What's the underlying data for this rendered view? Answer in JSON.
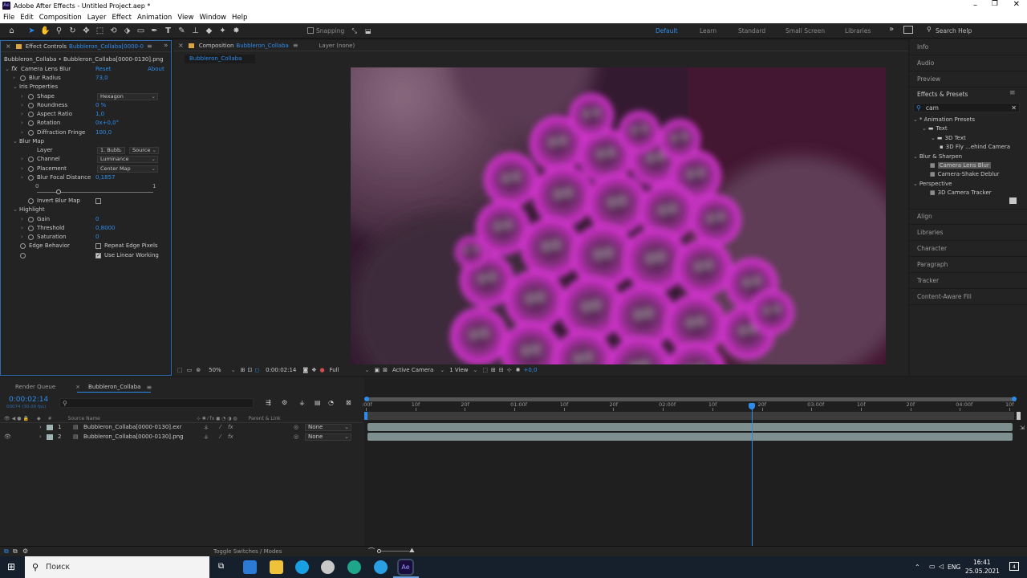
{
  "app": {
    "title": "Adobe After Effects - Untitled Project.aep *"
  },
  "menu": [
    "File",
    "Edit",
    "Composition",
    "Layer",
    "Effect",
    "Animation",
    "View",
    "Window",
    "Help"
  ],
  "toolbar": {
    "snapping": "Snapping",
    "workspaces": [
      "Default",
      "Learn",
      "Standard",
      "Small Screen",
      "Libraries"
    ],
    "search_placeholder": "Search Help"
  },
  "effect_controls": {
    "tab_prefix": "Effect Controls",
    "tab_layer": "Bubbleron_Collaba[0000-01:",
    "path": "Bubbleron_Collaba • Bubbleron_Collaba[0000-0130].png",
    "effect_name": "Camera Lens Blur",
    "reset": "Reset",
    "about": "About",
    "rows": [
      {
        "label": "Blur Radius",
        "value": "73,0",
        "indent": 1,
        "stopwatch": true
      },
      {
        "label": "Iris Properties",
        "indent": 1,
        "group": true
      },
      {
        "label": "Shape",
        "dropdown": "Hexagon",
        "indent": 2,
        "stopwatch": true
      },
      {
        "label": "Roundness",
        "value": "0 %",
        "indent": 2,
        "stopwatch": true
      },
      {
        "label": "Aspect Ratio",
        "value": "1,0",
        "indent": 2,
        "stopwatch": true
      },
      {
        "label": "Rotation",
        "value": "0x+0,0°",
        "indent": 2,
        "stopwatch": true
      },
      {
        "label": "Diffraction Fringe",
        "value": "100,0",
        "indent": 2,
        "stopwatch": true
      },
      {
        "label": "Blur Map",
        "indent": 1,
        "group": true
      },
      {
        "label": "Layer",
        "dropdown": "1. Bubb",
        "dropdown2": "Source",
        "indent": 2
      },
      {
        "label": "Channel",
        "dropdown": "Luminance",
        "indent": 2,
        "stopwatch": true
      },
      {
        "label": "Placement",
        "dropdown": "Center Map",
        "indent": 2,
        "stopwatch": true
      },
      {
        "label": "Blur Focal Distance",
        "value": "0,1857",
        "indent": 2,
        "stopwatch": true
      },
      {
        "label": "Invert Blur Map",
        "checkbox": false,
        "indent": 2,
        "stopwatch": true
      },
      {
        "label": "Highlight",
        "indent": 1,
        "group": true
      },
      {
        "label": "Gain",
        "value": "0",
        "indent": 2,
        "stopwatch": true
      },
      {
        "label": "Threshold",
        "value": "0,8000",
        "indent": 2,
        "stopwatch": true
      },
      {
        "label": "Saturation",
        "value": "0",
        "indent": 2,
        "stopwatch": true
      },
      {
        "label": "Edge Behavior",
        "checkbox_label": "Repeat Edge Pixels",
        "checkbox": false,
        "indent": 1,
        "stopwatch": true
      },
      {
        "label": "",
        "checkbox_label": "Use Linear Working",
        "checkbox": true,
        "indent": 1,
        "stopwatch": true
      }
    ],
    "slider_min": "0",
    "slider_max": "1",
    "slider_value": 0.1857
  },
  "composition": {
    "tab_prefix": "Composition",
    "tab_name": "Bubbleron_Collaba",
    "layer_tab": "Layer (none)",
    "subtab": "Bubbleron_Collaba",
    "zoom": "50%",
    "timecode": "0:00:02:14",
    "resolution": "Full",
    "camera": "Active Camera",
    "view": "1 View",
    "exposure": "+0,0"
  },
  "right_panel": {
    "top_items": [
      "Info",
      "Audio",
      "Preview"
    ],
    "effects_title": "Effects & Presets",
    "search": "cam",
    "tree": [
      {
        "label": "* Animation Presets",
        "indent": 0
      },
      {
        "label": "Text",
        "indent": 1
      },
      {
        "label": "3D Text",
        "indent": 2
      },
      {
        "label": "3D Fly ...ehind Camera",
        "indent": 3
      },
      {
        "label": "Blur & Sharpen",
        "indent": 0
      },
      {
        "label": "Camera Lens Blur",
        "indent": 1,
        "selected": true
      },
      {
        "label": "Camera-Shake Deblur",
        "indent": 1
      },
      {
        "label": "Perspective",
        "indent": 0
      },
      {
        "label": "3D Camera Tracker",
        "indent": 1
      }
    ],
    "bottom_items": [
      "Align",
      "Libraries",
      "Character",
      "Paragraph",
      "Tracker",
      "Content-Aware Fill"
    ]
  },
  "timeline": {
    "tabs": [
      "Render Queue",
      "Bubbleron_Collaba"
    ],
    "timecode": "0:00:02:14",
    "frames": "00074 (30.00 fps)",
    "col_source": "Source Name",
    "col_parent": "Parent & Link",
    "layers": [
      {
        "num": "1",
        "name": "Bubbleron_Collaba[0000-0130].exr",
        "parent": "None",
        "visible": false
      },
      {
        "num": "2",
        "name": "Bubbleron_Collaba[0000-0130].png",
        "parent": "None",
        "visible": true
      }
    ],
    "ruler": [
      ":00f",
      "10f",
      "20f",
      "01:00f",
      "10f",
      "20f",
      "02:00f",
      "10f",
      "20f",
      "03:00f",
      "10f",
      "20f",
      "04:00f",
      "10f"
    ],
    "playhead_fraction": 0.6,
    "toggle": "Toggle Switches / Modes"
  },
  "taskbar": {
    "search": "Поиск",
    "lang": "ENG",
    "time": "16:41",
    "date": "25.05.2021",
    "notif": "4"
  }
}
